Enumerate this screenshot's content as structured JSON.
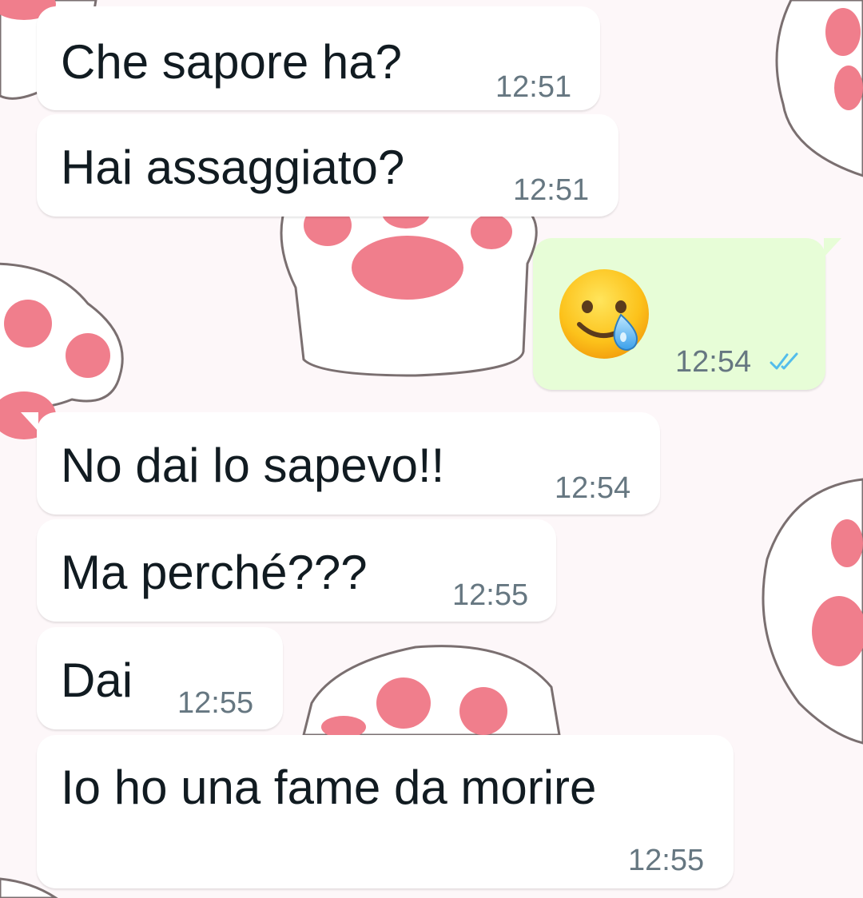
{
  "colors": {
    "incoming_bubble": "#ffffff",
    "outgoing_bubble": "#e7fdd7",
    "text": "#111b21",
    "timestamp": "#667781",
    "read_ticks": "#53bdeb",
    "paw_pad": "#f07e8c"
  },
  "wallpaper": {
    "pattern": "pink cat paws"
  },
  "messages": [
    {
      "direction": "in",
      "text": "Che sapore ha?",
      "time": "12:51"
    },
    {
      "direction": "in",
      "text": "Hai assaggiato?",
      "time": "12:51"
    },
    {
      "direction": "out",
      "emoji": "🥲",
      "emoji_name": "smiling-face-with-tear-icon",
      "time": "12:54",
      "status_icon": "double-check-read-icon"
    },
    {
      "direction": "in",
      "text": "No dai lo sapevo!!",
      "time": "12:54"
    },
    {
      "direction": "in",
      "text": "Ma perché???",
      "time": "12:55"
    },
    {
      "direction": "in",
      "text": "Dai",
      "time": "12:55"
    },
    {
      "direction": "in",
      "text": "Io ho una fame da morire",
      "time": "12:55"
    }
  ]
}
